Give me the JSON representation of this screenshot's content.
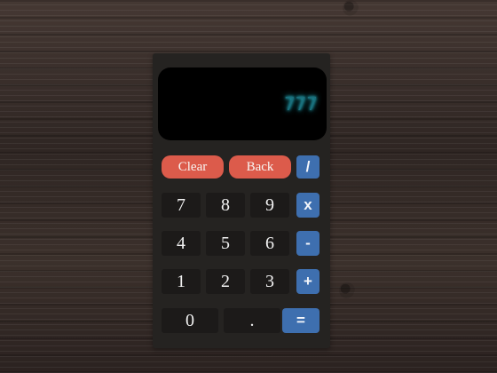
{
  "display": {
    "value": "777"
  },
  "buttons": {
    "clear": "Clear",
    "back": "Back",
    "divide": "/",
    "multiply": "x",
    "subtract": "-",
    "add": "+",
    "equals": "=",
    "decimal": ".",
    "digits": [
      "0",
      "1",
      "2",
      "3",
      "4",
      "5",
      "6",
      "7",
      "8",
      "9"
    ]
  },
  "colors": {
    "display_text": "#2bd2e6",
    "clear_back": "#dc5b4b",
    "operators": "#3e6faf",
    "digit_keys": "#1c1a19",
    "calculator_body": "#252321"
  }
}
